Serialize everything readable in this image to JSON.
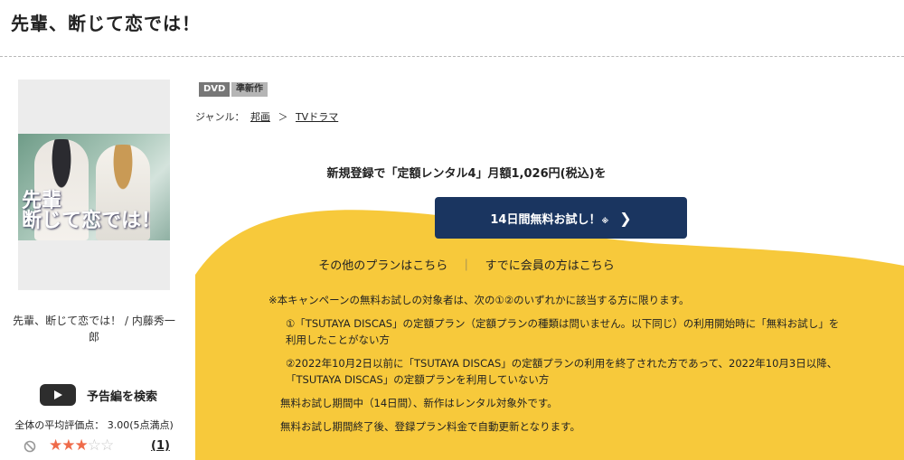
{
  "page": {
    "title": "先輩、断じて恋では！"
  },
  "jacket": {
    "art_title": "先輩\n断じて恋では！",
    "caption": "先輩、断じて恋では！ / 内藤秀一郎"
  },
  "badges": {
    "dvd": "DVD",
    "new": "準新作"
  },
  "genre": {
    "label": "ジャンル：",
    "items": [
      "邦画",
      "TVドラマ"
    ],
    "separator": "＞"
  },
  "trailer": {
    "label": "予告編を検索",
    "icon": "play-icon"
  },
  "rating": {
    "label": "全体の平均評価点： 3.00(5点満点)",
    "value": 3,
    "max": 5,
    "review_count": "(1)"
  },
  "promo": {
    "heading": "新規登録で「定額レンタル4」月額1,026円(税込)を",
    "button_label": "14日間無料お試し！",
    "button_note": "※",
    "other_plans": "その他のプランはこちら",
    "members": "すでに会員の方はこちら",
    "separator": "｜"
  },
  "notes": {
    "intro": "※本キャンペーンの無料お試しの対象者は、次の①②のいずれかに該当する方に限ります。",
    "item1_line1": "①「TSUTAYA DISCAS」の定額プラン（定額プランの種類は問いません。以下同じ）の利用開始時に「無料お試し」を",
    "item1_line2": "利用したことがない方",
    "item2_line1": "②2022年10月2日以前に「TSUTAYA DISCAS」の定額プランの利用を終了された方であって、2022年10月3日以降、",
    "item2_line2": "「TSUTAYA DISCAS」の定額プランを利用していない方",
    "period": "無料お試し期間中（14日間）、新作はレンタル対象外です。",
    "renewal": "無料お試し期間終了後、登録プラン料金で自動更新となります。"
  },
  "colors": {
    "accent_yellow": "#f7c93b",
    "button_navy": "#1a3560",
    "star": "#ef6b4a"
  }
}
